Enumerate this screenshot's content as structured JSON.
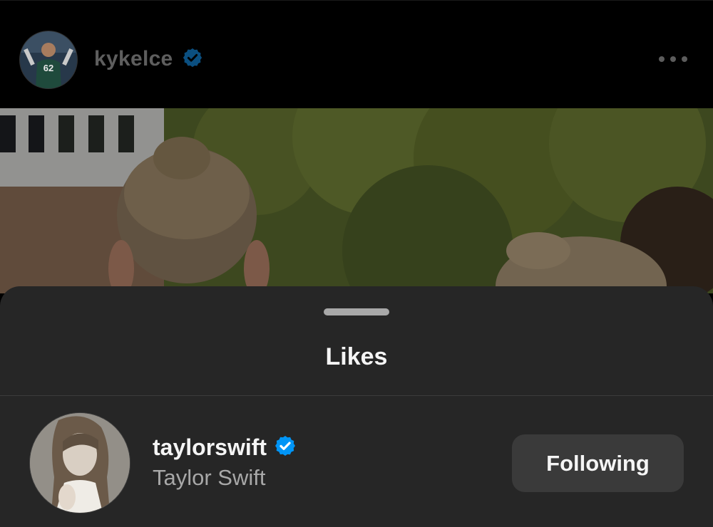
{
  "post": {
    "username": "kykelce",
    "verified": true,
    "avatar_icon": "football-player-avatar",
    "menu_icon": "more-horizontal-icon"
  },
  "likes_sheet": {
    "title": "Likes",
    "users": [
      {
        "handle": "taylorswift",
        "full_name": "Taylor Swift",
        "verified": true,
        "follow_status": "Following"
      }
    ]
  },
  "colors": {
    "verified_badge": "#0095f6",
    "verified_badge_dimmed": "#0b4f80",
    "sheet_background": "#262626",
    "button_background": "#3a3a3a"
  }
}
